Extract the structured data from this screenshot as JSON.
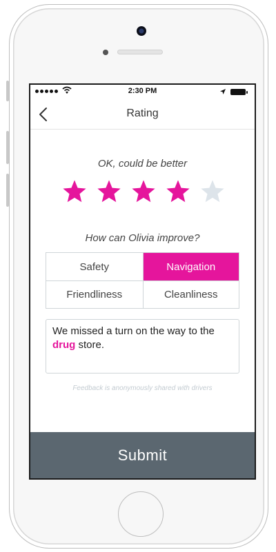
{
  "status_bar": {
    "time": "2:30 PM"
  },
  "nav": {
    "title": "Rating"
  },
  "rating": {
    "label": "OK, could be better",
    "value": 4,
    "max": 5,
    "filled_color": "#e5159c",
    "empty_color": "#dde4ea"
  },
  "improve": {
    "prompt": "How can Olivia improve?",
    "options": [
      {
        "label": "Safety",
        "selected": false
      },
      {
        "label": "Navigation",
        "selected": true
      },
      {
        "label": "Friendliness",
        "selected": false
      },
      {
        "label": "Cleanliness",
        "selected": false
      }
    ]
  },
  "feedback": {
    "text_before": "We missed a turn on the way to the ",
    "highlight": "drug",
    "text_after": " store."
  },
  "note": "Feedback is anonymously shared with drivers",
  "submit_label": "Submit",
  "colors": {
    "accent": "#e5159c",
    "submit_bg": "#5b6770"
  }
}
